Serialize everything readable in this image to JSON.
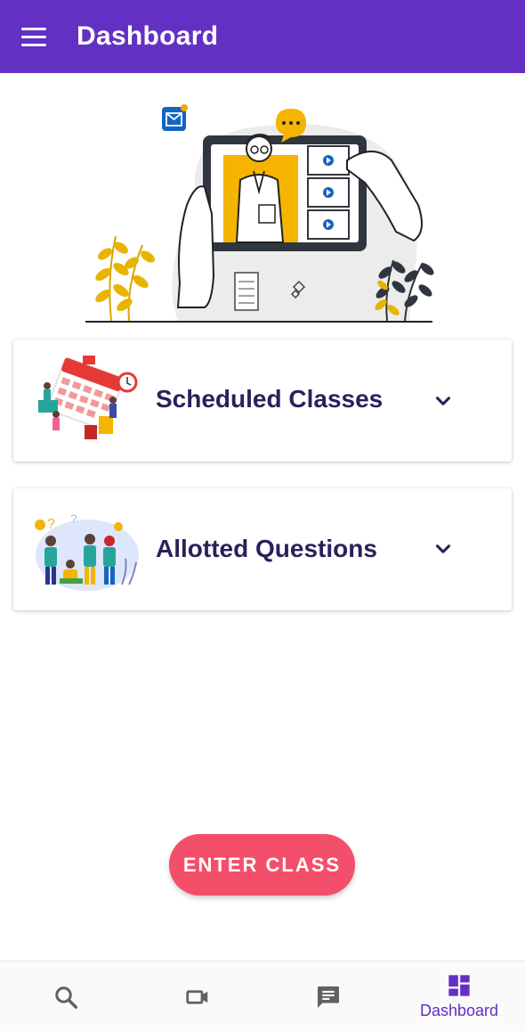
{
  "appbar": {
    "title": "Dashboard",
    "menu_icon": "menu-icon"
  },
  "hero": {
    "illustration": "online-teacher-illustration"
  },
  "cards": [
    {
      "title": "Scheduled Classes",
      "thumb": "calendar-illustration",
      "icon": "chevron-down-icon"
    },
    {
      "title": "Allotted Questions",
      "thumb": "students-questions-illustration",
      "icon": "chevron-down-icon"
    }
  ],
  "enter_button": {
    "label": "ENTER CLASS"
  },
  "bottom_nav": {
    "items": [
      {
        "icon": "search-icon",
        "label": ""
      },
      {
        "icon": "video-camera-icon",
        "label": ""
      },
      {
        "icon": "chat-icon",
        "label": ""
      },
      {
        "icon": "dashboard-icon",
        "label": "Dashboard",
        "active": true
      }
    ]
  },
  "colors": {
    "primary": "#6330c4",
    "accent_button": "#f34f6a",
    "card_title": "#2d1f5c",
    "nav_inactive": "#616161"
  }
}
